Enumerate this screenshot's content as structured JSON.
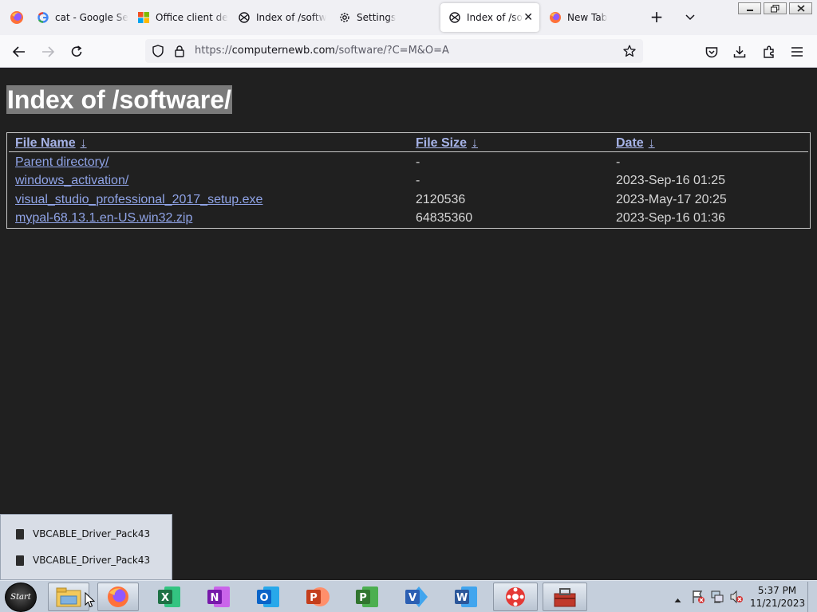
{
  "tabs": [
    {
      "label": "cat - Google Se",
      "icon": "google-icon"
    },
    {
      "label": "Office client de",
      "icon": "microsoft-icon"
    },
    {
      "label": "Index of /softw",
      "icon": "page-icon"
    },
    {
      "label": "Settings",
      "icon": "gear-icon"
    },
    {
      "label": "Index of /soft",
      "icon": "page-icon",
      "active": true
    },
    {
      "label": "New Tab",
      "icon": "firefox-icon"
    }
  ],
  "urlbar": {
    "scheme": "https://",
    "host": "computernewb.com",
    "path": "/software/?C=M&O=A"
  },
  "page": {
    "title": "Index of /software/",
    "headers": {
      "name": "File Name",
      "size": "File Size",
      "date": "Date",
      "sort_arrow": "↓"
    },
    "rows": [
      {
        "name": "Parent directory/",
        "size": "-",
        "date": "-"
      },
      {
        "name": "windows_activation/",
        "size": "-",
        "date": "2023-Sep-16 01:25"
      },
      {
        "name": "visual_studio_professional_2017_setup.exe",
        "size": "2120536",
        "date": "2023-May-17 20:25"
      },
      {
        "name": "mypal-68.13.1.en-US.win32.zip",
        "size": "64835360",
        "date": "2023-Sep-16 01:36"
      }
    ]
  },
  "jumplist": {
    "items": [
      "VBCABLE_Driver_Pack43",
      "VBCABLE_Driver_Pack43"
    ]
  },
  "taskbar": {
    "start_label": "Start",
    "apps": [
      "file-explorer-icon",
      "firefox-icon",
      "excel-icon",
      "onenote-icon",
      "outlook-icon",
      "powerpoint-icon",
      "project-icon",
      "visio-icon",
      "word-icon",
      "virtualbox-icon",
      "toolbox-icon"
    ],
    "app_letters": {
      "excel": "X",
      "onenote": "N",
      "outlook": "O",
      "powerpoint": "P",
      "project": "P",
      "visio": "V",
      "word": "W"
    },
    "clock_time": "5:37 PM",
    "clock_date": "11/21/2023"
  },
  "colors": {
    "page_bg": "#202020",
    "link": "#8fa3e6",
    "title_highlight": "#7a7a7a",
    "excel": "#1e7145",
    "onenote": "#7719aa",
    "outlook": "#0a64c8",
    "powerpoint": "#c43e1c",
    "project": "#31752f",
    "visio": "#2b5fb3",
    "word": "#2b579a"
  }
}
